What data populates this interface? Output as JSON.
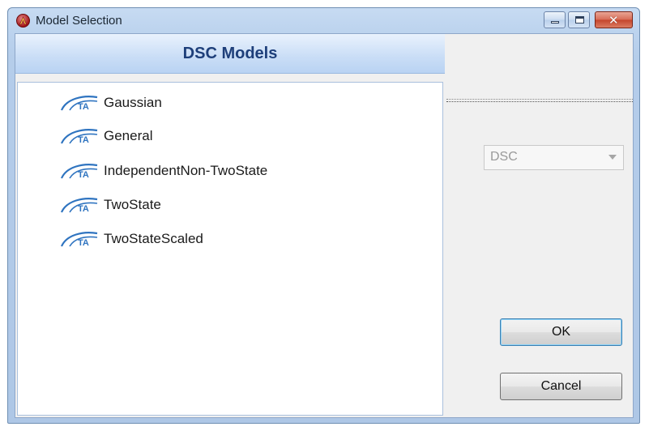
{
  "window": {
    "title": "Model Selection",
    "app_icon": "ta-app-icon",
    "controls": {
      "minimize": "minimize-icon",
      "maximize": "maximize-icon",
      "close": "close-icon"
    }
  },
  "panel": {
    "header": "DSC Models",
    "models": [
      {
        "label": "Gaussian",
        "icon": "ta-model-icon"
      },
      {
        "label": "General",
        "icon": "ta-model-icon"
      },
      {
        "label": "IndependentNon-TwoState",
        "icon": "ta-model-icon"
      },
      {
        "label": "TwoState",
        "icon": "ta-model-icon"
      },
      {
        "label": "TwoStateScaled",
        "icon": "ta-model-icon"
      }
    ]
  },
  "sidebar": {
    "type_select": {
      "selected": "DSC",
      "enabled": false
    },
    "ok_label": "OK",
    "cancel_label": "Cancel"
  }
}
